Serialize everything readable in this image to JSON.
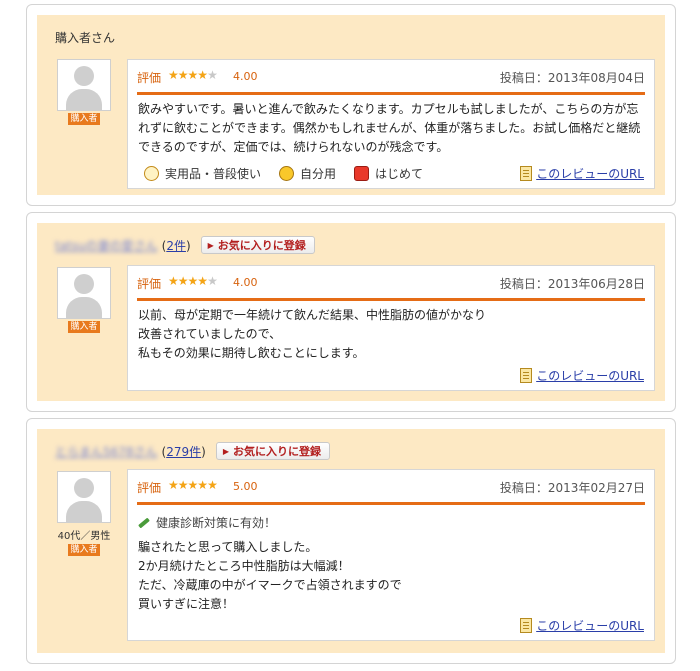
{
  "url_label": "このレビューのURL",
  "buyer_label": "購入者",
  "rating_label": "評価",
  "favorite_label": "お気に入りに登録",
  "reviews": [
    {
      "reviewer_name": "購入者さん",
      "rating": "4.00",
      "stars_filled": 4,
      "post_date": "投稿日：2013年08月04日",
      "body_lines": [
        "飲みやすいです。暑いと進んで飲みたくなります。カプセルも試しましたが、こちらの方が忘",
        "れずに飲むことができます。偶然かもしれませんが、体重が落ちました。お試し価格だと継続",
        "できるのですが、定価では、続けられないのが残念です。"
      ],
      "tags": [
        {
          "icon": "hand-icon",
          "label": "実用品・普段使い"
        },
        {
          "icon": "face-icon",
          "label": "自分用"
        },
        {
          "icon": "gift-icon",
          "label": "はじめて"
        }
      ]
    },
    {
      "reviewer_name": "tatsuの妻の愛さん",
      "review_count": "2件",
      "rating": "4.00",
      "stars_filled": 4,
      "post_date": "投稿日：2013年06月28日",
      "body_lines": [
        "以前、母が定期で一年続けて飲んだ結果、中性脂肪の値がかなり",
        "改善されていましたので、",
        "私もその効果に期待し飲むことにします。"
      ]
    },
    {
      "reviewer_name": "とらまん5678さん",
      "review_count": "279件",
      "reviewer_meta": "40代／男性",
      "rating": "5.00",
      "stars_filled": 5,
      "post_date": "投稿日：2013年02月27日",
      "tagline": "健康診断対策に有効！",
      "body_lines": [
        "騙されたと思って購入しました。",
        "2か月続けたところ中性脂肪は大幅減！",
        "ただ、冷蔵庫の中がイマークで占領されますので",
        "買いすぎに注意！"
      ]
    }
  ],
  "colors": {
    "panel_bg": "#fde9c4",
    "accent_orange": "#e56c16",
    "star_gold": "#f4a416",
    "link_blue": "#2a3ea8",
    "buyer_badge": "#e87a1e"
  }
}
